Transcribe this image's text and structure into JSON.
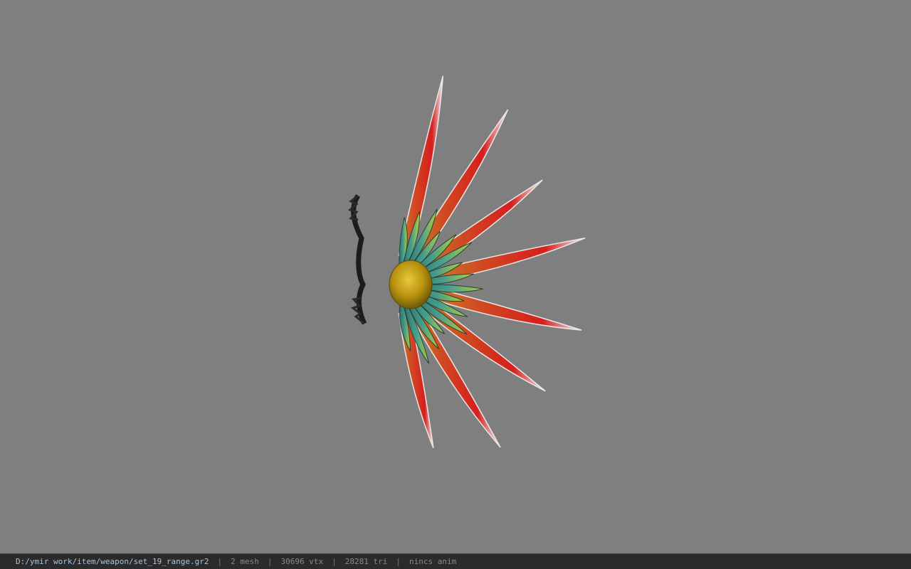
{
  "status_bar": {
    "file_path": "D:/ymir work/item/weapon/set_19_range.gr2",
    "separator": "|",
    "mesh_count": "2 mesh",
    "vertex_count": "30696 vtx",
    "triangle_count": "28281 tri",
    "anim_status": "nincs anim"
  },
  "colors": {
    "background": "#7f7f7f",
    "status_bar_bg": "#2b2b2b",
    "path_text": "#a9c4dc",
    "status_text": "#8a8a8a"
  }
}
